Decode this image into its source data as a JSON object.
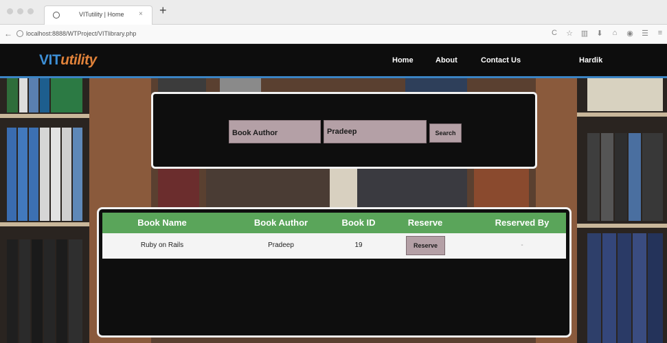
{
  "browser": {
    "tab_title": "VITutility | Home",
    "url": "localhost:8888/WTProject/VITlibrary.php",
    "tab_close": "×",
    "new_tab": "+",
    "back": "←",
    "toolbar_icons": [
      "reload-icon",
      "star-icon",
      "library-icon",
      "download-icon",
      "home-icon",
      "shield-icon",
      "chat-icon",
      "menu-icon"
    ],
    "toolbar_glyphs": [
      "C",
      "☆",
      "▥",
      "⬇",
      "⌂",
      "◉",
      "☰",
      "≡"
    ]
  },
  "site": {
    "logo_vit": "VIT",
    "logo_util": "utility",
    "nav": {
      "home": "Home",
      "about": "About",
      "contact": "Contact Us",
      "user": "Hardik"
    }
  },
  "search": {
    "field_label": "Book Author",
    "query": "Pradeep",
    "button_label": "Search"
  },
  "results": {
    "columns": [
      "Book Name",
      "Book Author",
      "Book ID",
      "Reserve",
      "Reserved By"
    ],
    "rows": [
      {
        "book_name": "Ruby on Rails",
        "book_author": "Pradeep",
        "book_id": "19",
        "reserve_label": "Reserve",
        "reserved_by": "-"
      }
    ]
  },
  "colors": {
    "nav_bg": "#0d0d0d",
    "accent_blue": "#3b84c4",
    "logo_orange": "#e0823a",
    "table_header": "#5aa55a",
    "input_bg": "#b4a0a6"
  }
}
